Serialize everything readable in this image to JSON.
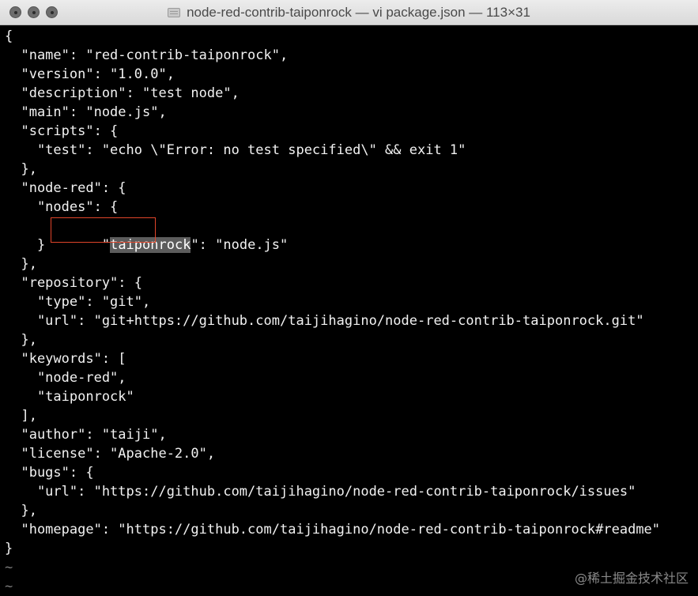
{
  "window": {
    "title": "node-red-contrib-taiponrock — vi package.json — 113×31",
    "buttons": [
      "close",
      "minimize",
      "zoom"
    ]
  },
  "editor": {
    "lines": [
      "{",
      "  \"name\": \"red-contrib-taiponrock\",",
      "  \"version\": \"1.0.0\",",
      "  \"description\": \"test node\",",
      "  \"main\": \"node.js\",",
      "  \"scripts\": {",
      "    \"test\": \"echo \\\"Error: no test specified\\\" && exit 1\"",
      "  },",
      "  \"node-red\": {",
      "    \"nodes\": {",
      "    }",
      "  },",
      "  \"repository\": {",
      "    \"type\": \"git\",",
      "    \"url\": \"git+https://github.com/taijihagino/node-red-contrib-taiponrock.git\"",
      "  },",
      "  \"keywords\": [",
      "    \"node-red\",",
      "    \"taiponrock\"",
      "  ],",
      "  \"author\": \"taiji\",",
      "  \"license\": \"Apache-2.0\",",
      "  \"bugs\": {",
      "    \"url\": \"https://github.com/taijihagino/node-red-contrib-taiponrock/issues\"",
      "  },",
      "  \"homepage\": \"https://github.com/taijihagino/node-red-contrib-taiponrock#readme\"",
      "}"
    ],
    "highlight_line": {
      "prefix": "      \"",
      "selected": "taiponrock",
      "suffix": "\": \"node.js\""
    },
    "tilde": "~"
  },
  "watermark": "@稀土掘金技术社区"
}
